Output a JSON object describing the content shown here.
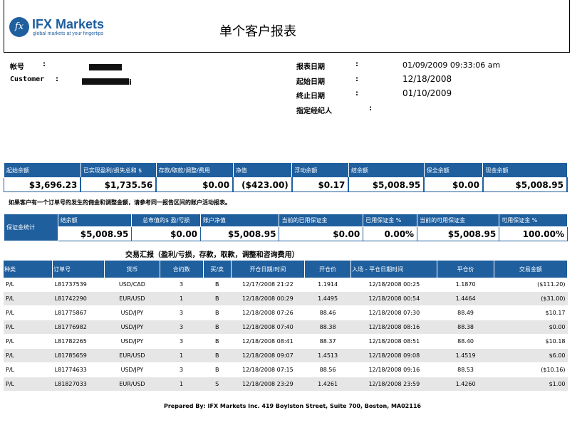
{
  "logo": {
    "mark": "fx",
    "name": "IFX Markets",
    "tagline": "global markets at your fingertips"
  },
  "title": "单个客户报表",
  "info_left": [
    {
      "label": "帐号",
      "colon": ":",
      "value": ""
    },
    {
      "label": "Customer",
      "colon": ":",
      "value": "i"
    }
  ],
  "info_right": [
    {
      "label": "报表日期",
      "colon": ":",
      "value": "01/09/2009 09:33:06 am"
    },
    {
      "label": "起始日期",
      "colon": ":",
      "value": "12/18/2008"
    },
    {
      "label": "终止日期",
      "colon": ":",
      "value": "01/10/2009"
    },
    {
      "label": "指定经纪人",
      "colon": ":",
      "value": ""
    }
  ],
  "balance": {
    "headers": [
      "起始余额",
      "已实现盈利/损失总和 $",
      "存款/取款/调整/费用",
      "净值",
      "浮动余额",
      "结余额",
      "保全余额",
      "现金余额"
    ],
    "values": [
      "$3,696.23",
      "$1,735.56",
      "$0.00",
      "($423.00)",
      "$0.17",
      "$5,008.95",
      "$0.00",
      "$5,008.95"
    ]
  },
  "note": "如果客户有一个订单号的发生的佣金和调整金额，请参考同一报告区间的账户活动报表。",
  "margin": {
    "label": "保证金统计",
    "headers": [
      "结余额",
      "总市值的$ 盈/亏损",
      "账户净值",
      "当前的已用保证金",
      "已用保证金 %",
      "当前的可用保证金",
      "可用保证金 %"
    ],
    "values": [
      "$5,008.95",
      "$0.00",
      "$5,008.95",
      "$0.00",
      "0.00%",
      "$5,008.95",
      "100.00%"
    ]
  },
  "trades": {
    "title": "交易汇报（盈利/亏损，存款，取款，调整和咨询费用）",
    "headers": [
      "种类",
      "订单号",
      "货币",
      "合约数",
      "买/卖",
      "开仓日期/时间",
      "开仓价",
      "入场 - 平仓日期时间",
      "平仓价",
      "交易金额"
    ],
    "rows": [
      [
        "P/L",
        "L81737539",
        "USD/CAD",
        "3",
        "B",
        "12/17/2008 21:22",
        "1.1914",
        "12/18/2008 00:25",
        "1.1870",
        "($111.20)"
      ],
      [
        "P/L",
        "L81742290",
        "EUR/USD",
        "1",
        "B",
        "12/18/2008 00:29",
        "1.4495",
        "12/18/2008 00:54",
        "1.4464",
        "($31.00)"
      ],
      [
        "P/L",
        "L81775867",
        "USD/JPY",
        "3",
        "B",
        "12/18/2008 07:26",
        "88.46",
        "12/18/2008 07:30",
        "88.49",
        "$10.17"
      ],
      [
        "P/L",
        "L81776982",
        "USD/JPY",
        "3",
        "B",
        "12/18/2008 07:40",
        "88.38",
        "12/18/2008 08:16",
        "88.38",
        "$0.00"
      ],
      [
        "P/L",
        "L81782265",
        "USD/JPY",
        "3",
        "B",
        "12/18/2008 08:41",
        "88.37",
        "12/18/2008 08:51",
        "88.40",
        "$10.18"
      ],
      [
        "P/L",
        "L81785659",
        "EUR/USD",
        "1",
        "B",
        "12/18/2008 09:07",
        "1.4513",
        "12/18/2008 09:08",
        "1.4519",
        "$6.00"
      ],
      [
        "P/L",
        "L81774633",
        "USD/JPY",
        "3",
        "B",
        "12/18/2008 07:15",
        "88.56",
        "12/18/2008 09:16",
        "88.53",
        "($10.16)"
      ],
      [
        "P/L",
        "L81827033",
        "EUR/USD",
        "1",
        "S",
        "12/18/2008 23:29",
        "1.4261",
        "12/18/2008 23:59",
        "1.4260",
        "$1.00"
      ]
    ]
  },
  "footer": "Prepared By: IFX Markets Inc.   419 Boylston Street, Suite 700, Boston, MA02116"
}
